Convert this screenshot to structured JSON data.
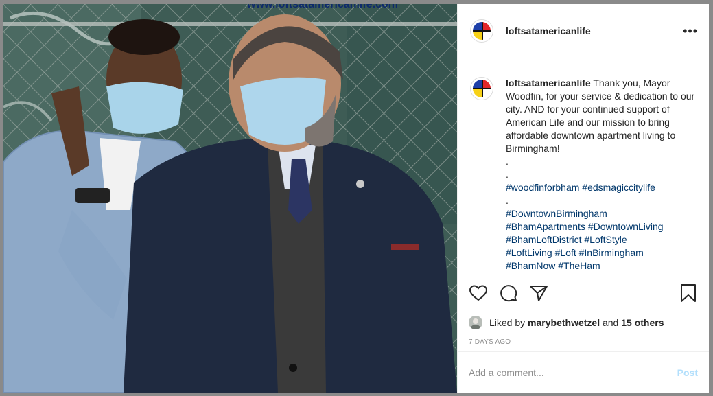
{
  "post": {
    "username": "loftsatamericanlife",
    "photo_watermark": "www.loftsatamericanlife.com",
    "caption": {
      "username": "loftsatamericanlife",
      "text": "Thank you, Mayor Woodfin, for your service & dedication to our city. AND for your continued support of American Life and our mission to bring affordable downtown apartment living to Birmingham!",
      "dot1": ".",
      "dot2": ".",
      "hashtags_line1": "#woodfinforbham #edsmagiccitylife",
      "dot3": ".",
      "hashtags": [
        "#DowntownBirmingham",
        "#BhamApartments #DowntownLiving",
        "#BhamLoftDistrict #LoftStyle",
        "#LoftLiving #Loft #InBirmingham",
        "#BhamNow #TheHam"
      ]
    },
    "likes": {
      "prefix": "Liked by",
      "user": "marybethwetzel",
      "and": "and",
      "others": "15 others"
    },
    "date": "7 DAYS AGO",
    "comment": {
      "placeholder": "Add a comment...",
      "post_label": "Post"
    },
    "icons": {
      "more": "more-options-icon",
      "like": "heart-icon",
      "comment": "comment-icon",
      "share": "share-icon",
      "save": "bookmark-icon"
    }
  },
  "colors": {
    "link": "#00376b",
    "post_disabled": "#b2dffc",
    "muted": "#8e8e8e",
    "text": "#262626"
  }
}
